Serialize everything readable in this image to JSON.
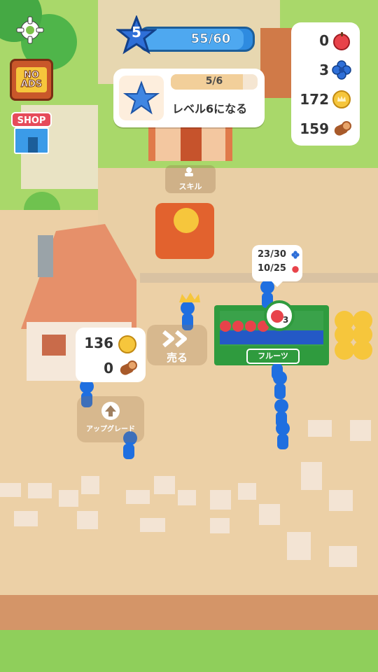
{
  "player": {
    "level": "5",
    "xp_text": "55/60",
    "xp_fraction": 0.9167
  },
  "quest": {
    "progress_text": "5/6",
    "progress_fraction": 0.8333,
    "title": "レベル6になる"
  },
  "resources": [
    {
      "value": "0",
      "icon": "apple-icon"
    },
    {
      "value": "3",
      "icon": "blue-flower-icon"
    },
    {
      "value": "172",
      "icon": "coin-icon"
    },
    {
      "value": "159",
      "icon": "log-icon"
    }
  ],
  "buttons": {
    "no_ads": "NO\nADS",
    "shop": "SHOP"
  },
  "fruit_stand": {
    "flowers": "23/30",
    "apples": "10/25",
    "badge": "3",
    "label": "フルーツ"
  },
  "sell": {
    "label": "売る"
  },
  "skill": {
    "label": "スキル"
  },
  "upgrade": {
    "label": "アップグレード",
    "coins": "136",
    "logs": "0"
  },
  "colors": {
    "accent_blue": "#2e8be0",
    "coin": "#f6c63c",
    "apple": "#e8434a",
    "stand_green": "#2f9b3e"
  }
}
